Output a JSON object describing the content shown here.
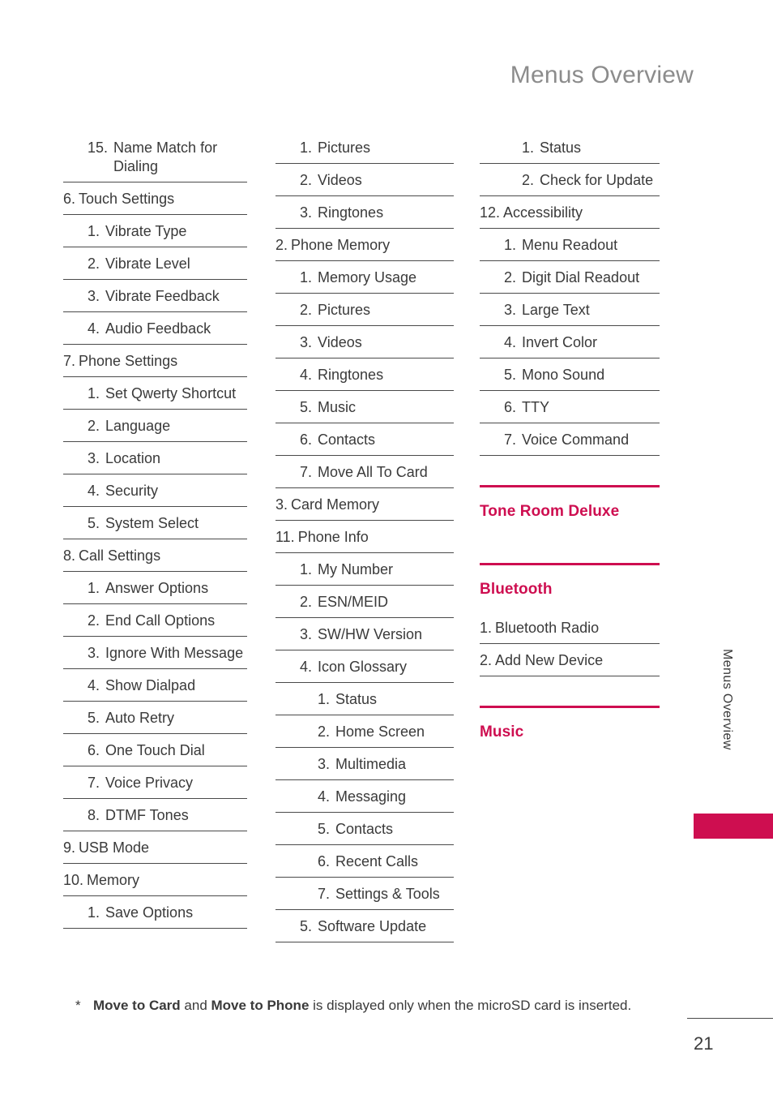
{
  "header": {
    "title": "Menus Overview"
  },
  "side_tab": {
    "label": "Menus Overview",
    "bar_color": "#CE0E50"
  },
  "accent_color": "#CE0E50",
  "columns": [
    {
      "name": "column-1",
      "rows": [
        {
          "level": 1,
          "num": "15.",
          "text": "Name Match for Dialing",
          "first": true
        },
        {
          "level": 0,
          "num": "6.",
          "text": "Touch Settings"
        },
        {
          "level": 1,
          "num": "1.",
          "text": "Vibrate Type"
        },
        {
          "level": 1,
          "num": "2.",
          "text": "Vibrate Level"
        },
        {
          "level": 1,
          "num": "3.",
          "text": "Vibrate Feedback"
        },
        {
          "level": 1,
          "num": "4.",
          "text": "Audio Feedback"
        },
        {
          "level": 0,
          "num": "7.",
          "text": "Phone Settings"
        },
        {
          "level": 1,
          "num": "1.",
          "text": "Set Qwerty Shortcut"
        },
        {
          "level": 1,
          "num": "2.",
          "text": "Language"
        },
        {
          "level": 1,
          "num": "3.",
          "text": "Location"
        },
        {
          "level": 1,
          "num": "4.",
          "text": "Security"
        },
        {
          "level": 1,
          "num": "5.",
          "text": "System Select"
        },
        {
          "level": 0,
          "num": "8.",
          "text": "Call Settings"
        },
        {
          "level": 1,
          "num": "1.",
          "text": "Answer Options"
        },
        {
          "level": 1,
          "num": "2.",
          "text": "End Call Options"
        },
        {
          "level": 1,
          "num": "3.",
          "text": "Ignore With Message"
        },
        {
          "level": 1,
          "num": "4.",
          "text": "Show Dialpad"
        },
        {
          "level": 1,
          "num": "5.",
          "text": "Auto Retry"
        },
        {
          "level": 1,
          "num": "6.",
          "text": "One Touch Dial"
        },
        {
          "level": 1,
          "num": "7.",
          "text": "Voice Privacy"
        },
        {
          "level": 1,
          "num": "8.",
          "text": "DTMF Tones"
        },
        {
          "level": 0,
          "num": "9.",
          "text": "USB Mode"
        },
        {
          "level": 0,
          "num": "10.",
          "text": "Memory"
        },
        {
          "level": 1,
          "num": "1.",
          "text": "Save Options"
        }
      ],
      "sections": []
    },
    {
      "name": "column-2",
      "rows": [
        {
          "level": 1,
          "num": "1.",
          "text": "Pictures",
          "first": true
        },
        {
          "level": 1,
          "num": "2.",
          "text": "Videos"
        },
        {
          "level": 1,
          "num": "3.",
          "text": "Ringtones"
        },
        {
          "level": 0,
          "num": "2.",
          "text": "Phone Memory"
        },
        {
          "level": 1,
          "num": "1.",
          "text": "Memory Usage"
        },
        {
          "level": 1,
          "num": "2.",
          "text": "Pictures"
        },
        {
          "level": 1,
          "num": "3.",
          "text": "Videos"
        },
        {
          "level": 1,
          "num": "4.",
          "text": "Ringtones"
        },
        {
          "level": 1,
          "num": "5.",
          "text": "Music"
        },
        {
          "level": 1,
          "num": "6.",
          "text": "Contacts"
        },
        {
          "level": 1,
          "num": "7.",
          "text": "Move All To Card"
        },
        {
          "level": 0,
          "num": "3.",
          "text": "Card Memory"
        },
        {
          "level": 0,
          "num": "11.",
          "text": "Phone Info"
        },
        {
          "level": 1,
          "num": "1.",
          "text": "My Number"
        },
        {
          "level": 1,
          "num": "2.",
          "text": "ESN/MEID"
        },
        {
          "level": 1,
          "num": "3.",
          "text": "SW/HW Version"
        },
        {
          "level": 1,
          "num": "4.",
          "text": "Icon Glossary"
        },
        {
          "level": 2,
          "num": "1.",
          "text": "Status"
        },
        {
          "level": 2,
          "num": "2.",
          "text": "Home Screen"
        },
        {
          "level": 2,
          "num": "3.",
          "text": "Multimedia"
        },
        {
          "level": 2,
          "num": "4.",
          "text": "Messaging"
        },
        {
          "level": 2,
          "num": "5.",
          "text": "Contacts"
        },
        {
          "level": 2,
          "num": "6.",
          "text": "Recent Calls"
        },
        {
          "level": 2,
          "num": "7.",
          "text": "Settings & Tools"
        },
        {
          "level": 1,
          "num": "5.",
          "text": "Software Update"
        }
      ],
      "sections": []
    },
    {
      "name": "column-3",
      "rows": [
        {
          "level": 2,
          "num": "1.",
          "text": "Status",
          "first": true
        },
        {
          "level": 2,
          "num": "2.",
          "text": "Check for Update"
        },
        {
          "level": 0,
          "num": "12.",
          "text": "Accessibility"
        },
        {
          "level": 1,
          "num": "1.",
          "text": "Menu Readout"
        },
        {
          "level": 1,
          "num": "2.",
          "text": "Digit Dial Readout"
        },
        {
          "level": 1,
          "num": "3.",
          "text": "Large Text"
        },
        {
          "level": 1,
          "num": "4.",
          "text": "Invert Color"
        },
        {
          "level": 1,
          "num": "5.",
          "text": "Mono Sound"
        },
        {
          "level": 1,
          "num": "6.",
          "text": "TTY"
        },
        {
          "level": 1,
          "num": "7.",
          "text": "Voice Command"
        }
      ],
      "sections": [
        {
          "title": "Tone Room Deluxe",
          "rows": []
        },
        {
          "title": "Bluetooth",
          "rows": [
            {
              "level": 0,
              "num": "1.",
              "text": "Bluetooth Radio"
            },
            {
              "level": 0,
              "num": "2.",
              "text": "Add New Device"
            }
          ]
        },
        {
          "title": "Music",
          "rows": []
        }
      ]
    }
  ],
  "footnote": {
    "star": "*",
    "bold_1": "Move to Card",
    "mid": " and ",
    "bold_2": "Move to Phone",
    "tail": " is displayed only when the microSD card is inserted."
  },
  "page_number": "21"
}
